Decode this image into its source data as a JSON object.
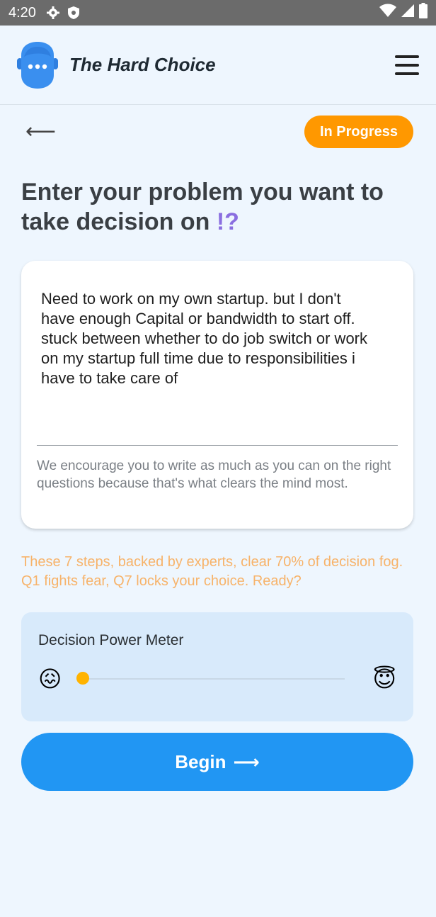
{
  "status_bar": {
    "time": "4:20",
    "icons": [
      "gear-icon",
      "shield-icon",
      "wifi-icon",
      "signal-icon",
      "battery-icon"
    ]
  },
  "header": {
    "title": "The Hard Choice",
    "logo_icon": "avatar-icon",
    "menu_icon": "hamburger-menu-icon"
  },
  "sub_bar": {
    "back_icon": "back-arrow-icon",
    "back_glyph": "⟵",
    "status_badge": "In Progress"
  },
  "question": {
    "text": "Enter your problem you want to take decision on ",
    "accent": "!?"
  },
  "card": {
    "input_value": "Need to work on my own startup. but I don't have enough Capital or bandwidth to start off. stuck between whether to do job switch or work on my startup full time due to responsibilities i have to take care of",
    "helper_text": "We encourage you to write as much as you can on the right questions because that's what clears the mind most."
  },
  "info_text": "These 7 steps, backed by experts, clear 70% of decision fog. Q1 fights fear, Q7 locks your choice. Ready?",
  "meter": {
    "title": "Decision Power Meter",
    "left_emoji": "😖",
    "right_emoji": "😇",
    "level": 0
  },
  "begin_button": {
    "label": "Begin",
    "arrow": "⟶"
  },
  "colors": {
    "accent_blue": "#2196f3",
    "badge_orange": "#ff9800",
    "info_orange": "#f7b36a",
    "question_accent": "#8a6ee0",
    "meter_bg": "#d8eafb",
    "page_bg": "#eef6fe"
  }
}
